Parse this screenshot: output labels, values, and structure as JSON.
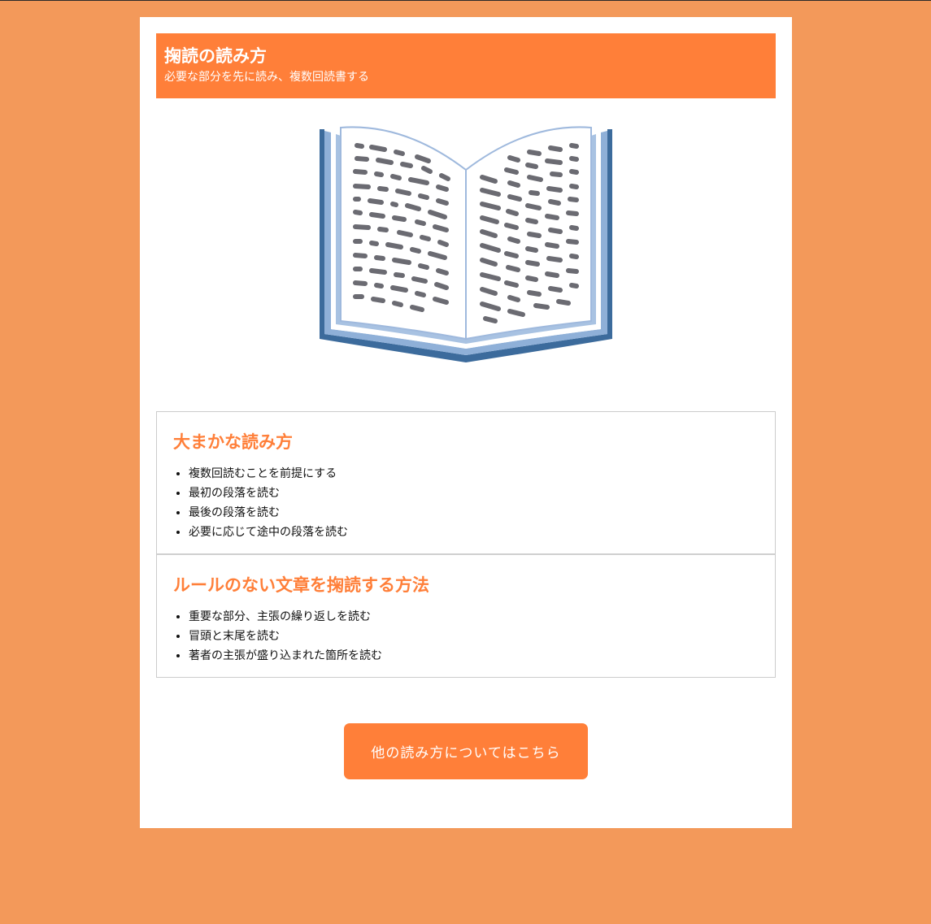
{
  "header": {
    "title": "掬読の読み方",
    "subtitle": "必要な部分を先に読み、複数回読書する"
  },
  "illustration": {
    "icon": "open-book-icon"
  },
  "sections": [
    {
      "title": "大まかな読み方",
      "items": [
        "複数回読むことを前提にする",
        "最初の段落を読む",
        "最後の段落を読む",
        "必要に応じて途中の段落を読む"
      ]
    },
    {
      "title": "ルールのない文章を掬読する方法",
      "items": [
        "重要な部分、主張の繰り返しを読む",
        "冒頭と末尾を読む",
        "著者の主張が盛り込まれた箇所を読む"
      ]
    }
  ],
  "cta": {
    "label": "他の読み方についてはこちら"
  },
  "colors": {
    "background": "#f3995a",
    "accent": "#ff7f39",
    "card": "#ffffff"
  }
}
